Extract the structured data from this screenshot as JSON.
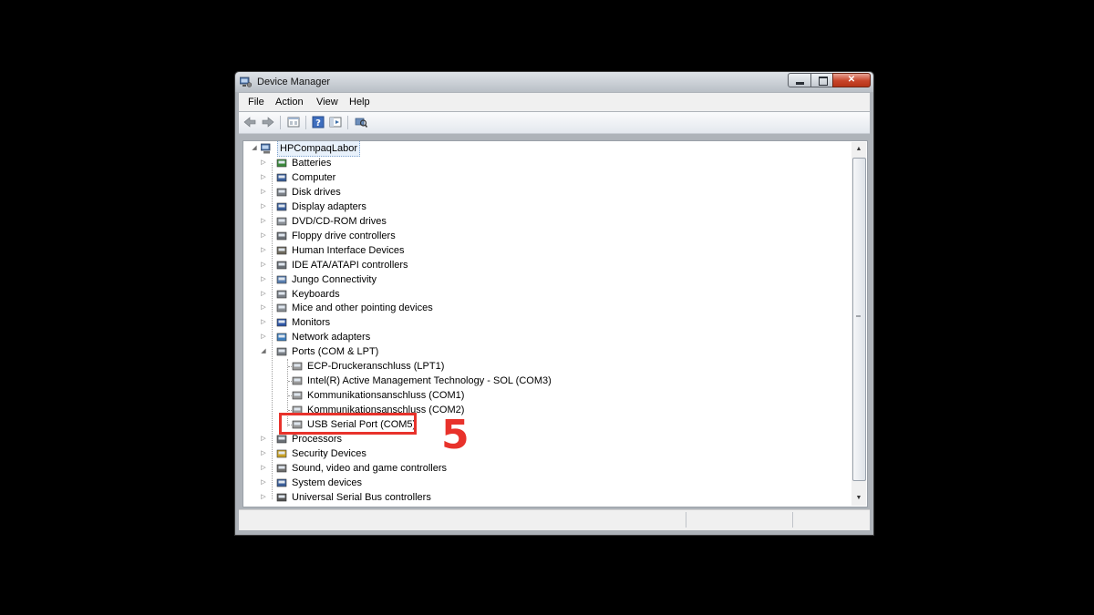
{
  "window": {
    "title": "Device Manager",
    "app_icon": "device-manager-icon"
  },
  "menu": [
    "File",
    "Action",
    "View",
    "Help"
  ],
  "toolbar": {
    "buttons": [
      "back-icon",
      "forward-icon",
      "properties-icon",
      "help-icon",
      "show-hide-console-tree-icon",
      "scan-hardware-icon"
    ]
  },
  "tree": {
    "root": "HPCompaqLabor",
    "categories": [
      {
        "label": "Batteries",
        "icon": "battery-icon"
      },
      {
        "label": "Computer",
        "icon": "computer-icon"
      },
      {
        "label": "Disk drives",
        "icon": "disk-drive-icon"
      },
      {
        "label": "Display adapters",
        "icon": "display-adapter-icon"
      },
      {
        "label": "DVD/CD-ROM drives",
        "icon": "dvd-drive-icon"
      },
      {
        "label": "Floppy drive controllers",
        "icon": "floppy-controller-icon"
      },
      {
        "label": "Human Interface Devices",
        "icon": "hid-icon"
      },
      {
        "label": "IDE ATA/ATAPI controllers",
        "icon": "ide-controller-icon"
      },
      {
        "label": "Jungo Connectivity",
        "icon": "jungo-icon"
      },
      {
        "label": "Keyboards",
        "icon": "keyboard-icon"
      },
      {
        "label": "Mice and other pointing devices",
        "icon": "mouse-icon"
      },
      {
        "label": "Monitors",
        "icon": "monitor-icon"
      },
      {
        "label": "Network adapters",
        "icon": "network-adapter-icon"
      },
      {
        "label": "Ports (COM & LPT)",
        "icon": "port-icon",
        "expanded": true
      },
      {
        "label": "Processors",
        "icon": "processor-icon"
      },
      {
        "label": "Security Devices",
        "icon": "security-device-icon"
      },
      {
        "label": "Sound, video and game controllers",
        "icon": "sound-icon"
      },
      {
        "label": "System devices",
        "icon": "system-device-icon"
      },
      {
        "label": "Universal Serial Bus controllers",
        "icon": "usb-icon"
      }
    ],
    "ports_children": [
      "ECP-Druckeranschluss (LPT1)",
      "Intel(R) Active Management Technology - SOL (COM3)",
      "Kommunikationsanschluss (COM1)",
      "Kommunikationsanschluss (COM2)",
      "USB Serial Port (COM5)"
    ]
  },
  "annotation": {
    "step_number": "5",
    "color": "#e8322b"
  },
  "colors": {
    "highlight": "#e8322b",
    "titlebar": "#dfe3e8",
    "selection": "#e8f1fb"
  }
}
